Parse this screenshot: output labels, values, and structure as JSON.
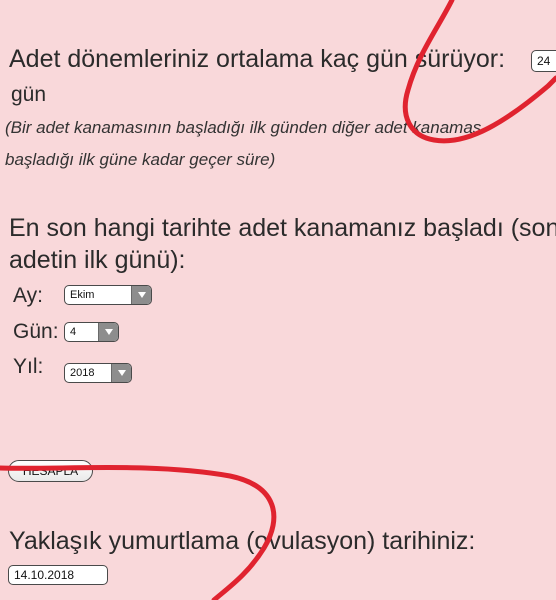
{
  "question1": {
    "title": "Adet dönemleriniz ortalama kaç gün sürüyor:",
    "input_value": "24",
    "unit": "gün",
    "note_line1": "(Bir adet kanamasının  başladığı ilk günden diğer adet kanamas",
    "note_line2": "başladığı ilk güne kadar geçer süre)"
  },
  "question2": {
    "title_line1": "En son hangi tarihte adet kanamanız başladı (son",
    "title_line2": "adetin ilk günü):",
    "month_label": "Ay:",
    "month_value": "Ekim",
    "day_label": "Gün:",
    "day_value": "4",
    "year_label": "Yıl:",
    "year_value": "2018"
  },
  "calculate_button": "HESAPLA",
  "result": {
    "title": "Yaklaşık yumurtlama (ovulasyon) tarihiniz:",
    "value": "14.10.2018"
  },
  "colors": {
    "background": "#f9d8da",
    "annotation_stroke": "#e0232f",
    "select_arrow": "#8d8d8d"
  }
}
